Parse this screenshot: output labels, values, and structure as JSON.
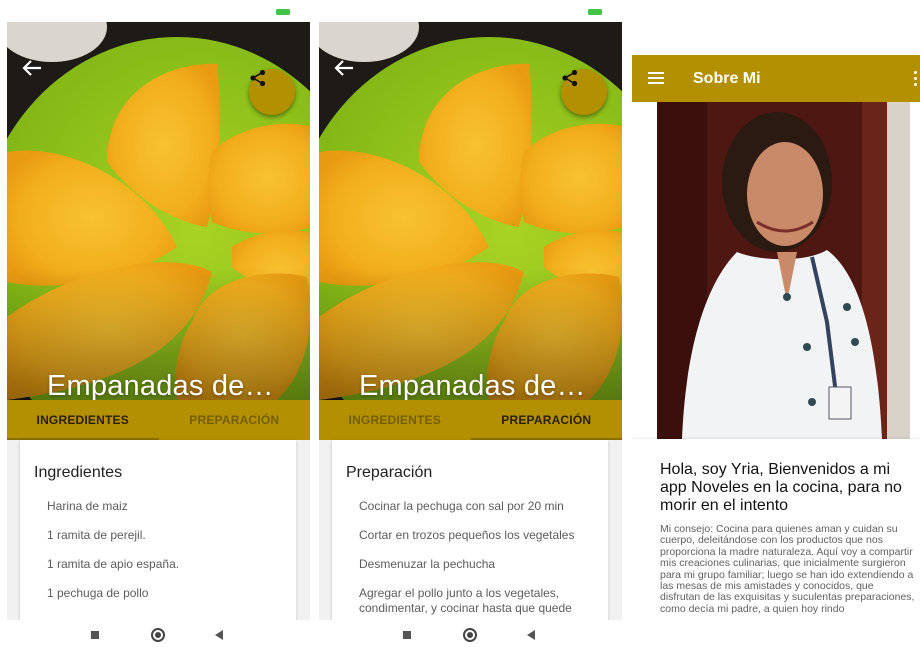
{
  "colors": {
    "accent": "#b39000",
    "card_bg": "#ffffff",
    "body_text": "#5c5c5c"
  },
  "recipe_screens": [
    {
      "title": "Empanadas de…",
      "tabs": [
        {
          "label": "INGREDIENTES",
          "active": true
        },
        {
          "label": "PREPARACIÓN",
          "active": false
        }
      ],
      "section_title": "Ingredientes",
      "items": [
        "Harina de maiz",
        "1 ramita de perejil.",
        "1 ramita de apio españa.",
        "1 pechuga de pollo"
      ]
    },
    {
      "title": "Empanadas de…",
      "tabs": [
        {
          "label": "INGREDIENTES",
          "active": false
        },
        {
          "label": "PREPARACIÓN",
          "active": true
        }
      ],
      "section_title": "Preparación",
      "items": [
        "Cocinar la pechuga con sal por 20 min",
        "Cortar en trozos pequeños los vegetales",
        "Desmenuzar la pechucha",
        "Agregar el pollo junto a los vegetales, condimentar, y cocinar hasta que quede"
      ]
    }
  ],
  "icons": {
    "back": "arrow-left-icon",
    "share": "share-icon",
    "menu": "hamburger-menu-icon",
    "overflow": "more-vert-icon"
  },
  "about": {
    "appbar_title": "Sobre Mi",
    "heading": "Hola, soy Yria, Bienvenidos a mi app Noveles en la cocina, para no morir en el intento",
    "body": "Mi consejo: Cocina para quienes aman y cuidan su cuerpo, deleitándose con los productos que nos proporciona la madre naturaleza. Aquí voy a compartir mis creaciones culinarias, que inicialmente surgieron para mi grupo familiar; luego se han ido extendiendo a las mesas de mis amistades y conocidos, que disfrutan de las exquisitas y suculentas preparaciones, como decía mi padre, a quien hoy rindo"
  }
}
